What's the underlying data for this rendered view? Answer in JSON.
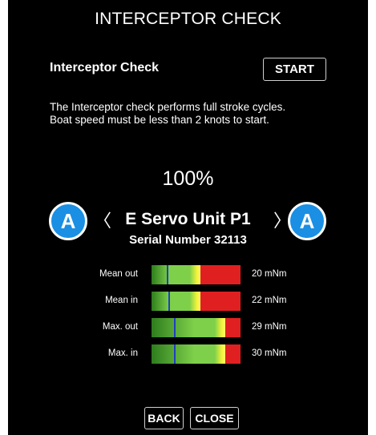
{
  "header": {
    "title": "INTERCEPTOR CHECK"
  },
  "section": {
    "heading": "Interceptor Check",
    "start_label": "START"
  },
  "description": "The Interceptor check performs full stroke cycles. Boat speed must be less than 2 knots to start.",
  "progress": {
    "percent_text": "100%",
    "value": 1.0
  },
  "unit": {
    "name": "E Servo Unit P1",
    "serial": "Serial Number 32113",
    "prev_icon": "chevron-left-icon",
    "next_icon": "chevron-right-icon",
    "badge_left": "A",
    "badge_right": "A"
  },
  "measurements": [
    {
      "label": "Mean out",
      "value": "20 mNm",
      "marker": 0.18,
      "yellow_end": 0.55
    },
    {
      "label": "Mean in",
      "value": "22 mNm",
      "marker": 0.2,
      "yellow_end": 0.55
    },
    {
      "label": "Max. out",
      "value": "29 mNm",
      "marker": 0.26,
      "yellow_end": 0.83
    },
    {
      "label": "Max. in",
      "value": "30 mNm",
      "marker": 0.26,
      "yellow_end": 0.83
    }
  ],
  "footer": {
    "back_label": "BACK",
    "close_label": "CLOSE"
  },
  "colors": {
    "background": "#000000",
    "badge": "#1a8fe3",
    "bar_green_dark": "#2e7d1e",
    "bar_green_light": "#7ed04a",
    "bar_yellow": "#f3f33a",
    "bar_red": "#e02020",
    "marker": "#1f3fbf"
  }
}
